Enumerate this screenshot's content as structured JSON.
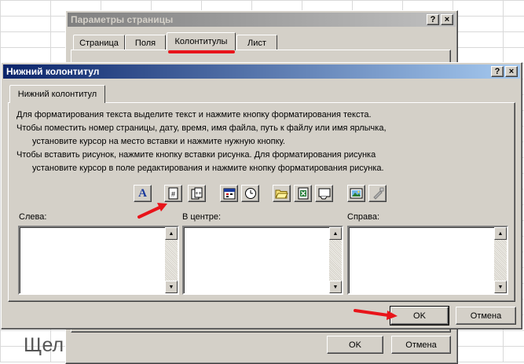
{
  "background": {
    "caption": "Щел"
  },
  "page_setup": {
    "title": "Параметры страницы",
    "help_btn": "?",
    "close_btn": "×",
    "tabs": [
      {
        "label": "Страница",
        "selected": false
      },
      {
        "label": "Поля",
        "selected": false
      },
      {
        "label": "Колонтитулы",
        "selected": true
      },
      {
        "label": "Лист",
        "selected": false
      }
    ],
    "ok_label": "OK",
    "cancel_label": "Отмена"
  },
  "footer_dialog": {
    "title": "Нижний колонтитул",
    "help_btn": "?",
    "close_btn": "×",
    "tab_label": "Нижний колонтитул",
    "instructions": [
      "Для форматирования текста выделите текст и нажмите кнопку форматирования текста.",
      "Чтобы поместить номер страницы, дату, время, имя файла, путь к файлу или имя ярлычка,",
      "установите курсор на место вставки и нажмите нужную кнопку.",
      "Чтобы вставить рисунок, нажмите кнопку вставки рисунка.  Для форматирования рисунка",
      "установите курсор в поле редактирования и нажмите кнопку форматирования рисунка."
    ],
    "toolbar": {
      "font": "A",
      "page_number": "#",
      "total_pages": "++"
    },
    "sections": {
      "left": "Слева:",
      "center": "В центре:",
      "right": "Справа:"
    },
    "ok_label": "OK",
    "cancel_label": "Отмена"
  },
  "colors": {
    "annotation": "#e8141a",
    "title_active": "#0a246a",
    "title_inactive": "#808080",
    "face": "#d4d0c8"
  }
}
